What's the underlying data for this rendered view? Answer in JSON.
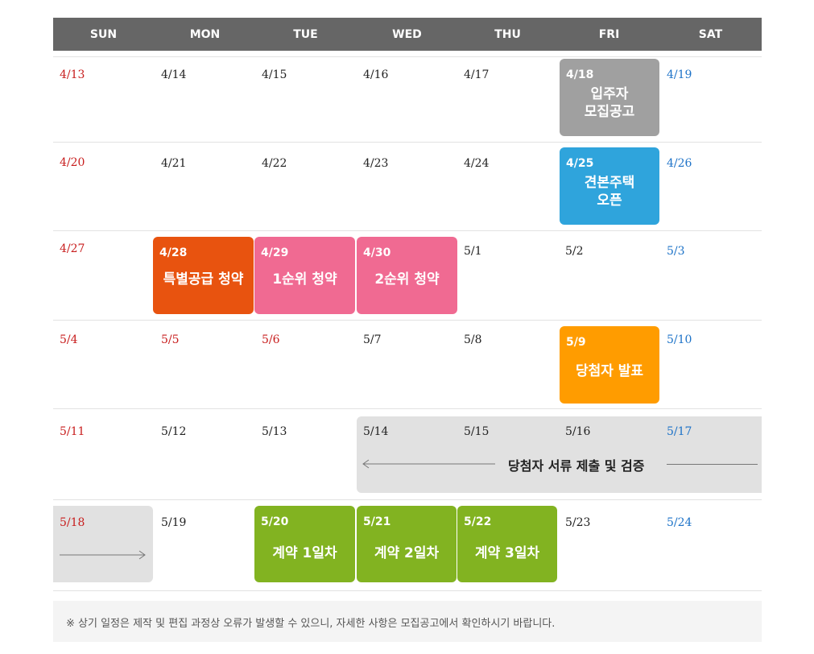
{
  "weekdays": [
    "SUN",
    "MON",
    "TUE",
    "WED",
    "THU",
    "FRI",
    "SAT"
  ],
  "dates": {
    "r1": [
      "4/13",
      "4/14",
      "4/15",
      "4/16",
      "4/17",
      "4/18",
      "4/19"
    ],
    "r2": [
      "4/20",
      "4/21",
      "4/22",
      "4/23",
      "4/24",
      "4/25",
      "4/26"
    ],
    "r3": [
      "4/27",
      "4/28",
      "4/29",
      "4/30",
      "5/1",
      "5/2",
      "5/3"
    ],
    "r4": [
      "5/4",
      "5/5",
      "5/6",
      "5/7",
      "5/8",
      "5/9",
      "5/10"
    ],
    "r5": [
      "5/11",
      "5/12",
      "5/13",
      "5/14",
      "5/15",
      "5/16",
      "5/17"
    ],
    "r6": [
      "5/18",
      "5/19",
      "5/20",
      "5/21",
      "5/22",
      "5/23",
      "5/24"
    ]
  },
  "events": {
    "announcement": {
      "line1": "입주자",
      "line2": "모집공고"
    },
    "model_house": {
      "line1": "견본주택",
      "line2": "오픈"
    },
    "special_supply": "특별공급 청약",
    "first_priority": "1순위 청약",
    "second_priority": "2순위 청약",
    "winner_announcement": "당첨자 발표",
    "document_review": "당첨자 서류 제출 및 검증",
    "contract_day1": "계약 1일차",
    "contract_day2": "계약 2일차",
    "contract_day3": "계약 3일차"
  },
  "colors": {
    "header_bg": "#666666",
    "holiday_red": "#c81e1e",
    "saturday_blue": "#1e73c8",
    "announcement_gray": "#a0a0a0",
    "model_house_blue": "#2fa4dc",
    "special_supply_orange": "#e8530f",
    "priority_pink": "#f06a92",
    "winner_amber": "#ff9c00",
    "contract_green": "#82b321",
    "review_lightgray": "#e1e1e1"
  },
  "footnote": "※ 상기 일정은 제작 및 편집 과정상 오류가 발생할 수 있으니, 자세한 사항은 모집공고에서 확인하시기 바랍니다."
}
